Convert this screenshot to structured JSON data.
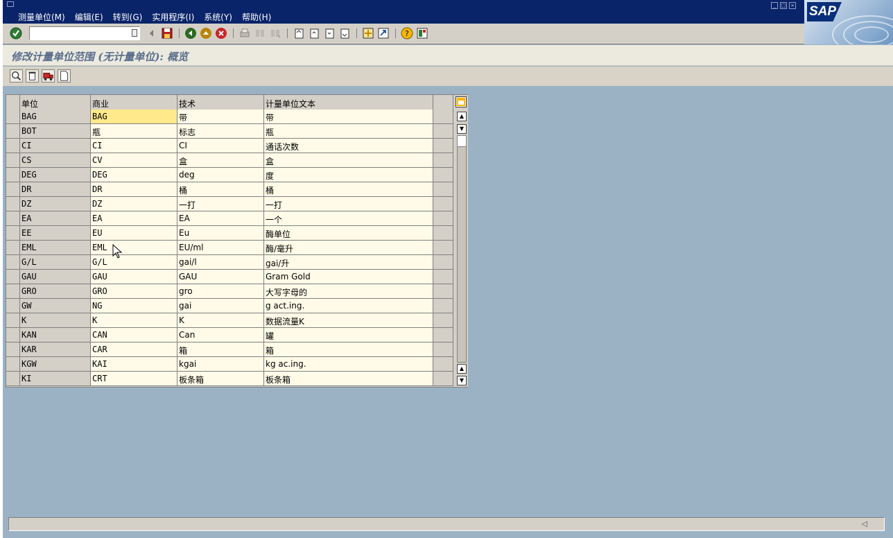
{
  "menu": {
    "items": [
      "测量单位(M)",
      "编辑(E)",
      "转到(G)",
      "实用程序(I)",
      "系统(Y)",
      "帮助(H)"
    ]
  },
  "logo": {
    "text": "SAP"
  },
  "command_field": {
    "value": ""
  },
  "title": "修改计量单位范围 (无计量单位): 概览",
  "grid": {
    "columns": [
      "单位",
      "商业",
      "技术",
      "计量单位文本"
    ],
    "rows": [
      [
        "BAG",
        "BAG",
        "带",
        "带"
      ],
      [
        "BOT",
        "瓶",
        "标志",
        "瓶"
      ],
      [
        "CI",
        "CI",
        "CI",
        "通话次数"
      ],
      [
        "CS",
        "CV",
        "盒",
        "盒"
      ],
      [
        "DEG",
        "DEG",
        "deg",
        "度"
      ],
      [
        "DR",
        "DR",
        "桶",
        "桶"
      ],
      [
        "DZ",
        "DZ",
        "一打",
        "一打"
      ],
      [
        "EA",
        "EA",
        "EA",
        "一个"
      ],
      [
        "EE",
        "EU",
        "Eu",
        "酶单位"
      ],
      [
        "EML",
        "EML",
        "EU/ml",
        "酶/毫升"
      ],
      [
        "G/L",
        "G/L",
        "gai/l",
        "gai/升"
      ],
      [
        "GAU",
        "GAU",
        "GAU",
        "Gram Gold"
      ],
      [
        "GRO",
        "GRO",
        "gro",
        "大写字母的"
      ],
      [
        "GW",
        "NG",
        "gai",
        "g act.ing."
      ],
      [
        "K",
        "K",
        "K",
        "数据流量K"
      ],
      [
        "KAN",
        "CAN",
        "Can",
        "罐"
      ],
      [
        "KAR",
        "CAR",
        "箱",
        "箱"
      ],
      [
        "KGW",
        "KAI",
        "kgai",
        "kg ac.ing."
      ],
      [
        "KI",
        "CRT",
        "板条箱",
        "板条箱"
      ]
    ],
    "selected_cell": {
      "row": 0,
      "column": "商业"
    }
  },
  "colors": {
    "menubar": "#0a246a",
    "background": "#9bb2c4",
    "cell_input": "#fffbe8",
    "cell_selected": "#ffe98a",
    "title_text": "#5a6e8c"
  }
}
